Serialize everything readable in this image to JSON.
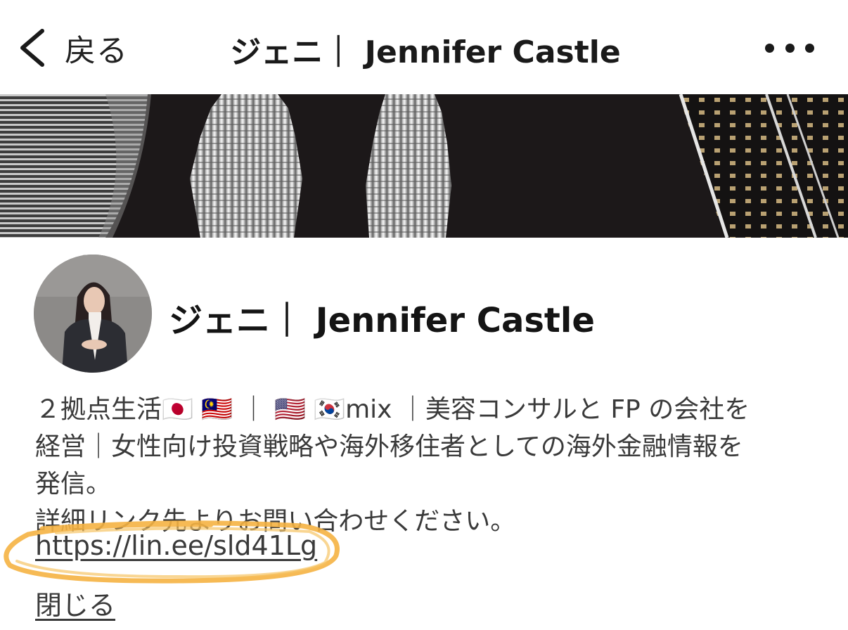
{
  "navbar": {
    "back_label": "戻る",
    "title": "ジェニ｜ Jennifer Castle",
    "more_icon": "ellipsis-icon",
    "back_icon": "chevron-left-icon"
  },
  "profile": {
    "name": "ジェニ｜ Jennifer Castle",
    "bio_lines": [
      "２拠点生活🇯🇵 🇲🇾 ｜ 🇺🇸 🇰🇷mix ｜美容コンサルと FP の会社を",
      "経営｜女性向け投資戦略や海外移住者としての海外金融情報を",
      "発信。",
      "詳細リンク先よりお問い合わせください。"
    ],
    "link": "https://lin.ee/sld41Lg",
    "close_label": "閉じる"
  },
  "colors": {
    "highlight_ring": "#f5b342",
    "text": "#3a3a3a",
    "cover_bg": "#1a1718"
  }
}
